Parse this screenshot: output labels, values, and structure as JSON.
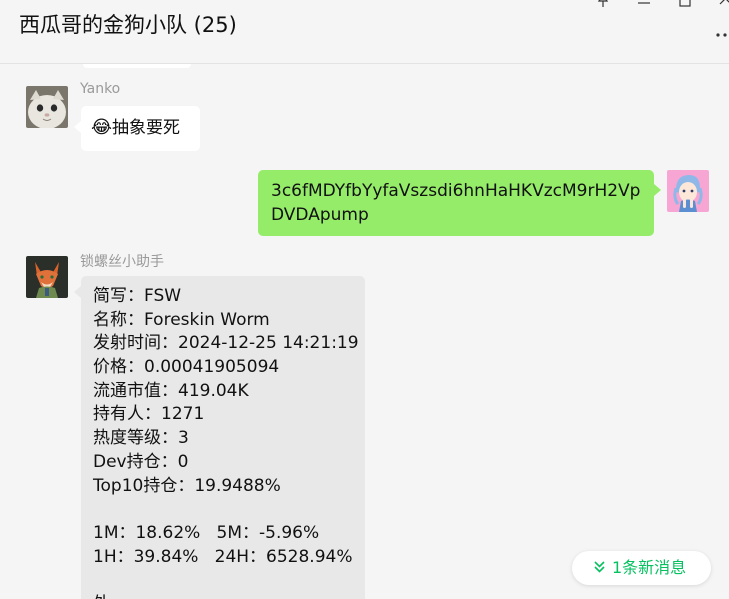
{
  "header": {
    "title": "西瓜哥的金狗小队 (25)",
    "controls": [
      "pin-icon",
      "minimize-icon",
      "maximize-icon",
      "close-icon",
      "more-icon"
    ]
  },
  "messages": [
    {
      "sender": "Yanko",
      "avatar": "white-cat-avatar",
      "emoji": "😂",
      "text": "抽象要死"
    },
    {
      "self": true,
      "avatar": "anime-girl-avatar",
      "lines": [
        "3c6fMDYfbYyfaVszsdi6hnHaHKVzcM9rH2Vp",
        "DVDApump"
      ]
    },
    {
      "sender": "锁螺丝小助手",
      "avatar": "fox-avatar",
      "lines": [
        "简写：FSW",
        "名称：Foreskin Worm",
        "发射时间：2024-12-25 14:21:19",
        "价格：0.00041905094",
        "流通市值：419.04K",
        "持有人：1271",
        "热度等级：3",
        "Dev持仓：0",
        "Top10持仓：19.9488%",
        "",
        "1M：18.62%   5M：-5.96%",
        "1H：39.84%   24H：6528.94%",
        "",
        "外"
      ]
    }
  ],
  "new_message_button": {
    "icon": "double-chevron-down-icon",
    "label": "1条新消息"
  },
  "colors": {
    "background": "#f5f5f5",
    "self_bubble": "#95ec69",
    "other_bubble": "#ffffff",
    "bot_bubble": "#e8e8e8",
    "accent": "#07c160"
  }
}
